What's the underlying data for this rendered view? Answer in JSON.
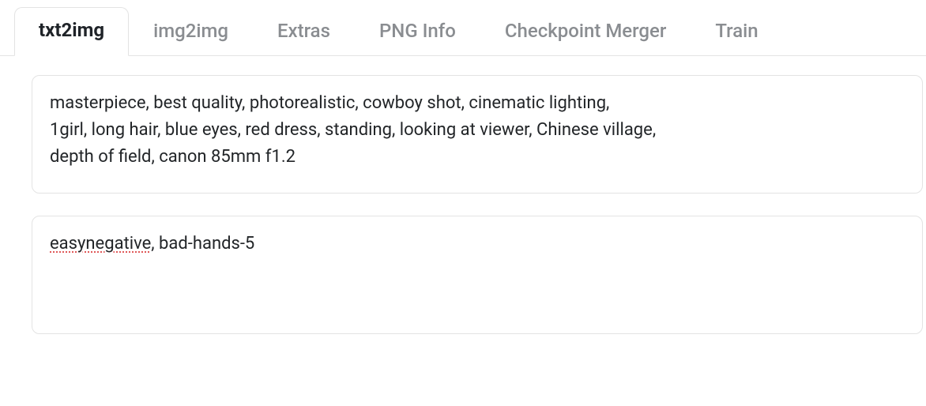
{
  "tabs": {
    "txt2img": "txt2img",
    "img2img": "img2img",
    "extras": "Extras",
    "pnginfo": "PNG Info",
    "checkpoint_merger": "Checkpoint Merger",
    "train": "Train",
    "active": "txt2img"
  },
  "prompt": {
    "positive": "masterpiece, best quality, photorealistic, cowboy shot, cinematic lighting,\n1girl, long hair, blue eyes, red dress, standing, looking at viewer, Chinese village,\ndepth of field, canon 85mm f1.2",
    "negative_pre": "easynegative",
    "negative_post": ", bad-hands-5"
  }
}
